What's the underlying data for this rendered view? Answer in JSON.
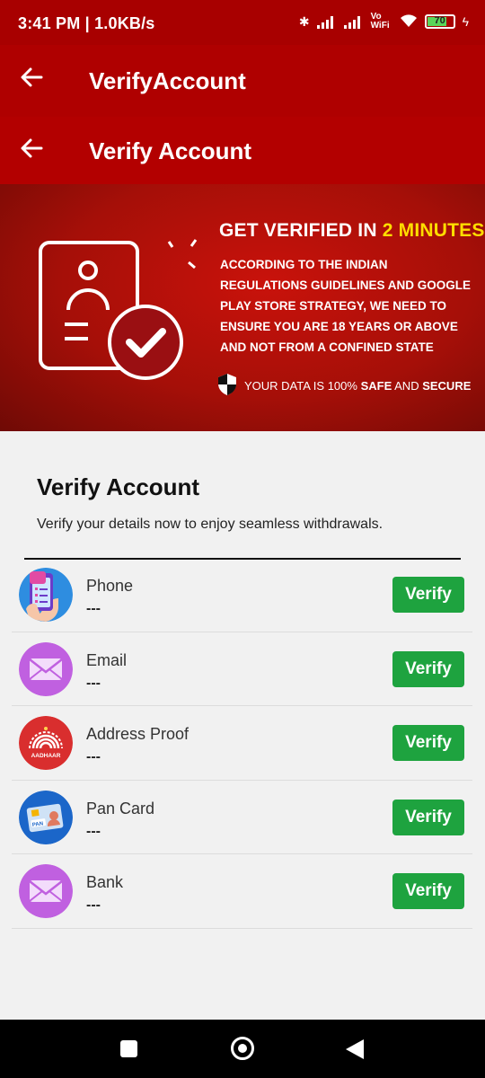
{
  "status_bar": {
    "time": "3:41 PM | 1.0KB/s",
    "battery_level": "70",
    "network_label": "Vo WiFi"
  },
  "appbar_top": {
    "title": "VerifyAccount"
  },
  "appbar_second": {
    "title": "Verify Account"
  },
  "banner": {
    "headline_prefix": "GET VERIFIED IN ",
    "headline_highlight": "2 MINUTES",
    "description": "ACCORDING TO THE INDIAN REGULATIONS GUIDELINES AND GOOGLE PLAY STORE STRATEGY, WE NEED TO ENSURE YOU ARE 18 YEARS OR ABOVE AND NOT FROM A CONFINED STATE",
    "safe_prefix": "YOUR DATA IS 100% ",
    "safe_bold1": "SAFE",
    "safe_mid": " AND ",
    "safe_bold2": "SECURE"
  },
  "section": {
    "title": "Verify Account",
    "subtitle": "Verify your details now to enjoy seamless withdrawals."
  },
  "items": [
    {
      "label": "Phone",
      "value": "---",
      "button": "Verify",
      "icon": "phone-icon"
    },
    {
      "label": "Email",
      "value": "---",
      "button": "Verify",
      "icon": "email-icon"
    },
    {
      "label": "Address Proof",
      "value": "---",
      "button": "Verify",
      "icon": "aadhaar-icon",
      "icon_text": "AADHAAR"
    },
    {
      "label": "Pan Card",
      "value": "---",
      "button": "Verify",
      "icon": "pan-card-icon",
      "icon_text": "PAN"
    },
    {
      "label": "Bank",
      "value": "---",
      "button": "Verify",
      "icon": "bank-email-icon"
    }
  ],
  "colors": {
    "header": "#b30000",
    "verify_button": "#1ea33f",
    "highlight": "#ffdd00"
  }
}
